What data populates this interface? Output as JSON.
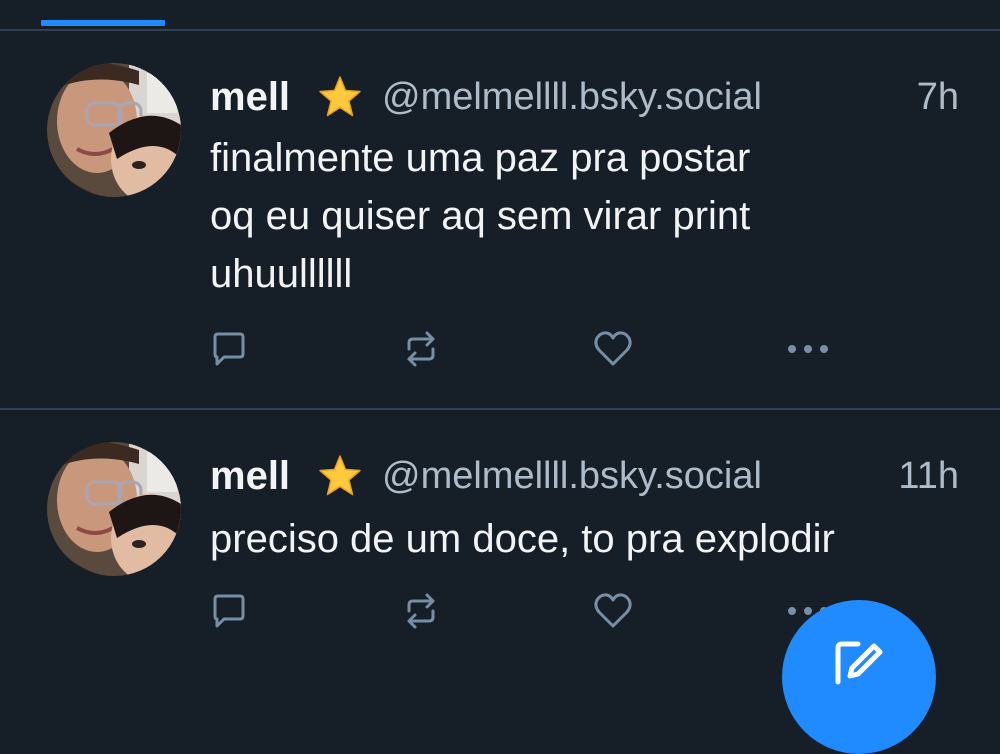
{
  "colors": {
    "background": "#161e27",
    "accent": "#208bfe",
    "divider": "#2e4052",
    "text_primary": "#f1f3f5",
    "text_secondary": "#aebbc9"
  },
  "posts": [
    {
      "display_name": "mell",
      "badge": "⭐",
      "handle": "@melmellll.bsky.social",
      "time": "7h",
      "text": "finalmente uma paz pra postar\noq eu quiser aq sem virar print\nuhuullllll",
      "actions": [
        "reply-icon",
        "repost-icon",
        "like-icon",
        "more-icon"
      ]
    },
    {
      "display_name": "mell",
      "badge": "⭐",
      "handle": "@melmellll.bsky.social",
      "time": "11h",
      "text": "preciso de um doce, to pra explodir",
      "actions": [
        "reply-icon",
        "repost-icon",
        "like-icon",
        "more-icon"
      ]
    }
  ],
  "fab": {
    "icon": "compose-icon"
  }
}
